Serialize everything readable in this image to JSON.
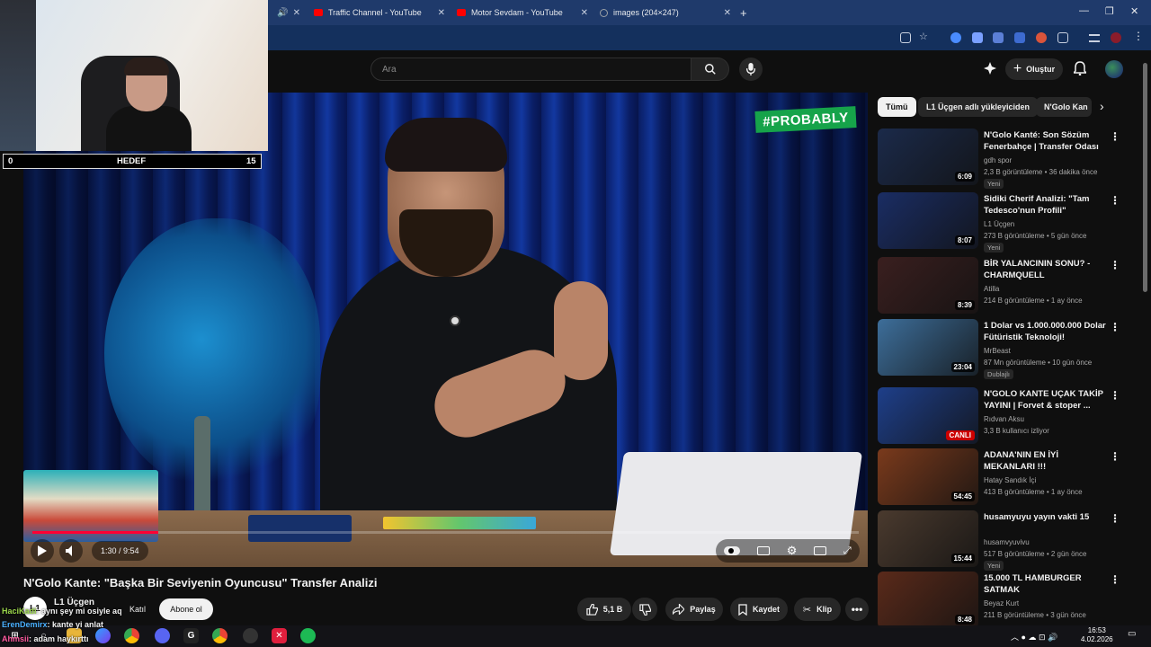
{
  "browser": {
    "tabs": [
      {
        "label": "Traffic Channel - YouTube",
        "favicon": "youtube-icon"
      },
      {
        "label": "Motor Sevdam - YouTube",
        "favicon": "youtube-icon"
      },
      {
        "label": "images (204×247)",
        "favicon": "image-icon"
      }
    ],
    "new_tab": "+"
  },
  "header": {
    "search_placeholder": "Ara",
    "create_label": "Oluştur"
  },
  "player": {
    "overlay_text": "#PROBABLY",
    "time": "1:30 / 9:54",
    "progress": 0.152
  },
  "video": {
    "title": "N'Golo Kante: \"Başka Bir Seviyenin Oyuncusu\" Transfer Analizi",
    "channel": "L1 Üçgen",
    "channel_avatar_text": "L1",
    "join_label": "Katıl",
    "subscribe_label": "Abone ol",
    "likes": "5,1 B",
    "share_label": "Paylaş",
    "save_label": "Kaydet",
    "clip_label": "Klip"
  },
  "chips": [
    "Tümü",
    "L1 Üçgen adlı yükleyiciden",
    "N'Golo Kan"
  ],
  "recommendations": [
    {
      "title": "N'Golo Kanté: Son Sözüm Fenerbahçe | Transfer Odası",
      "channel": "gdh spor",
      "meta": "2,3 B görüntüleme • 36 dakika önce",
      "badge": "Yeni",
      "duration": "6:09",
      "thumb_color": "#1b2a4a"
    },
    {
      "title": "Sidiki Cherif Analizi: \"Tam Tedesco'nun Profili\"",
      "channel": "L1 Üçgen",
      "meta": "273 B görüntüleme • 5 gün önce",
      "badge": "Yeni",
      "duration": "8:07",
      "thumb_color": "#1a2d64"
    },
    {
      "title": "BİR YALANCININ SONU? - CHARMQUELL",
      "channel": "Atilla",
      "meta": "214 B görüntüleme • 1 ay önce",
      "badge": "",
      "duration": "8:39",
      "thumb_color": "#3a1f1f"
    },
    {
      "title": "1 Dolar vs 1.000.000.000 Dolar Fütüristik Teknoloji!",
      "channel": "MrBeast",
      "meta": "87 Mn görüntüleme • 10 gün önce",
      "badge": "Dublajlı",
      "duration": "23:04",
      "thumb_color": "#3d6e9a"
    },
    {
      "title": "N'GOLO KANTE UÇAK TAKİP YAYINI | Forvet & stoper ...",
      "channel": "Rıdvan Aksu",
      "meta": "3,3 B kullanıcı izliyor",
      "badge": "",
      "duration": "CANLI",
      "thumb_color": "#1e3f8a"
    },
    {
      "title": "ADANA'NIN EN İYİ MEKANLARI !!!",
      "channel": "Hatay Sandık İçi",
      "meta": "413 B görüntüleme • 1 ay önce",
      "badge": "",
      "duration": "54:45",
      "thumb_color": "#7a3a1c"
    },
    {
      "title": "husamyuyu yayın vakti 15",
      "channel": "husamvyuvivu",
      "meta": "517 B görüntüleme • 2 gün önce",
      "badge": "Yeni",
      "duration": "15:44",
      "thumb_color": "#4a3a2e"
    },
    {
      "title": "15.000 TL HAMBURGER SATMAK",
      "channel": "Beyaz Kurt",
      "meta": "211 B görüntüleme • 3 gün önce",
      "badge": "",
      "duration": "8:48",
      "thumb_color": "#5a2a1a"
    }
  ],
  "overlay": {
    "goal_left": "0",
    "goal_label": "HEDEF",
    "goal_right": "15",
    "chat": [
      {
        "user": "HaciKadi",
        "msg": "aynı şey mi osiyle aq",
        "color": "#9bd64b"
      },
      {
        "user": "ErenDemirx",
        "msg": "kante yi anlat",
        "color": "#4ab0ff"
      },
      {
        "user": "Ahmsii",
        "msg": "adam haykırttı",
        "color": "#ff5aa0"
      }
    ]
  },
  "taskbar": {
    "time": "16:53",
    "date": "4.02.2026"
  },
  "colors": {
    "accent": "#ff0033",
    "brand_green": "#16a34a",
    "background": "#0f0f0f"
  }
}
